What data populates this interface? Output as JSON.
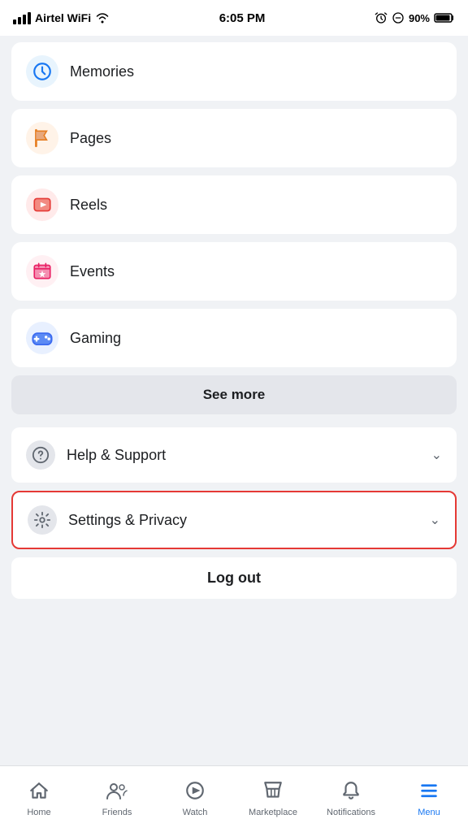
{
  "statusBar": {
    "carrier": "Airtel WiFi",
    "time": "6:05 PM",
    "battery": "90%"
  },
  "menuItems": [
    {
      "id": "memories",
      "label": "Memories",
      "icon": "⏱",
      "iconBg": "#e8f4fd",
      "partial": true
    },
    {
      "id": "pages",
      "label": "Pages",
      "icon": "🚩",
      "iconBg": "#fff3e8"
    },
    {
      "id": "reels",
      "label": "Reels",
      "icon": "▶",
      "iconBg": "#ffeaea"
    },
    {
      "id": "events",
      "label": "Events",
      "icon": "⭐",
      "iconBg": "#fff0f3"
    },
    {
      "id": "gaming",
      "label": "Gaming",
      "icon": "🎮",
      "iconBg": "#e8f0ff"
    }
  ],
  "seeMore": {
    "label": "See more"
  },
  "helpSupport": {
    "label": "Help & Support"
  },
  "settingsPrivacy": {
    "label": "Settings & Privacy"
  },
  "logout": {
    "label": "Log out"
  },
  "bottomNav": {
    "items": [
      {
        "id": "home",
        "label": "Home",
        "icon": "home"
      },
      {
        "id": "friends",
        "label": "Friends",
        "icon": "friends"
      },
      {
        "id": "watch",
        "label": "Watch",
        "icon": "watch"
      },
      {
        "id": "marketplace",
        "label": "Marketplace",
        "icon": "marketplace"
      },
      {
        "id": "notifications",
        "label": "Notifications",
        "icon": "bell"
      },
      {
        "id": "menu",
        "label": "Menu",
        "icon": "menu",
        "active": true
      }
    ]
  }
}
